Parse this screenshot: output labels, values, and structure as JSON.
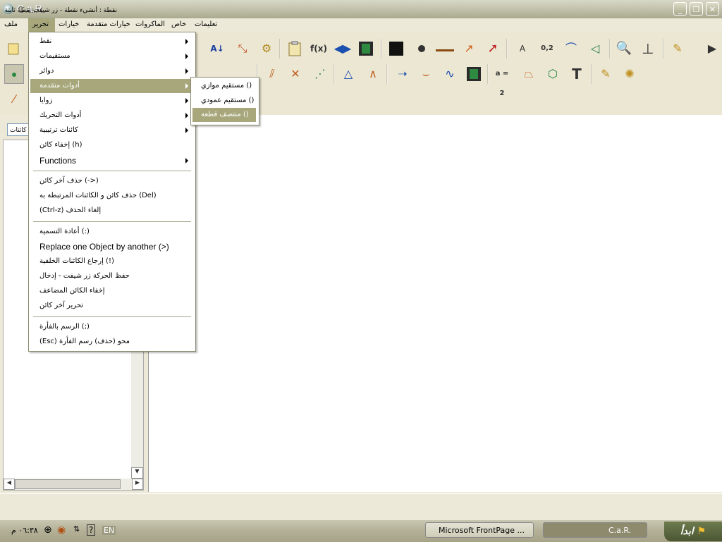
{
  "window": {
    "title": "C.a.R."
  },
  "menubar": [
    {
      "label": "ملف",
      "key": "file"
    },
    {
      "label": "تحرير",
      "key": "edit"
    },
    {
      "label": "خيارات",
      "key": "options"
    },
    {
      "label": "خيارات متقدمة",
      "key": "advanced"
    },
    {
      "label": "الماكروات",
      "key": "macros"
    },
    {
      "label": "خاص",
      "key": "special"
    },
    {
      "label": "تعليمات",
      "key": "help"
    }
  ],
  "toolbar": {
    "row1": [
      "f(x)",
      "0,2",
      "A",
      "T"
    ],
    "row2_labels": [
      "a = 2"
    ]
  },
  "edit_menu": {
    "items": [
      {
        "label": "نقط",
        "submenu": true
      },
      {
        "label": "مستقيمات",
        "submenu": true
      },
      {
        "label": "دوائر",
        "submenu": true
      },
      {
        "label": "أدوات متقدمة",
        "submenu": true,
        "highlighted": true
      },
      {
        "label": "زوايا",
        "submenu": true
      },
      {
        "label": "أدوات التحريك",
        "submenu": true
      },
      {
        "label": "كائنات ترتيبية",
        "submenu": true
      },
      {
        "label": "إخفاء كائن (h)",
        "submenu": false
      },
      {
        "label": "Functions",
        "submenu": true
      }
    ],
    "group2": [
      {
        "label": "حذف آخر كائن     (->)"
      },
      {
        "label": "حذف كائن و الكائنات المرتبطة به (Del)"
      },
      {
        "label": "(Ctrl-z)        إلغاء الحذف"
      }
    ],
    "group3": [
      {
        "label": "أعادة التسمية (:)"
      },
      {
        "label": "Replace one Object by another (>)"
      },
      {
        "label": "إرجاع الكائنات الخلفية (!)"
      },
      {
        "label": "حفظ الحركة زر شيفت - إدخال"
      },
      {
        "label": "إخفاء الكائن المضاعف"
      },
      {
        "label": "تحرير آخر كائن"
      }
    ],
    "group4": [
      {
        "label": "الرسم بالفأرة (;)"
      },
      {
        "label": "(Esc)     محو (حذف) رسم الفأرة"
      }
    ]
  },
  "submenu": {
    "items": [
      {
        "label": "مستقيم موازي ()"
      },
      {
        "label": "مستقيم عمودي ()"
      },
      {
        "label": "منتصف قطعة ()",
        "highlighted": true
      }
    ]
  },
  "leftpanel": {
    "combo_value": "كائنات"
  },
  "statusbar": {
    "text": "نقطة : أنشيء نقطة - زر شيفت نقطة ثابتة"
  },
  "taskbar": {
    "start_label": "ابدأ",
    "tasks": [
      "C.a.R.",
      "Microsoft FrontPage ..."
    ],
    "clock": "٠٦:٣٨ م",
    "lang": "EN"
  },
  "colors": {
    "highlight": "#A7A77B",
    "title": "#BDBDA6",
    "menubg": "#ECE9D8"
  }
}
